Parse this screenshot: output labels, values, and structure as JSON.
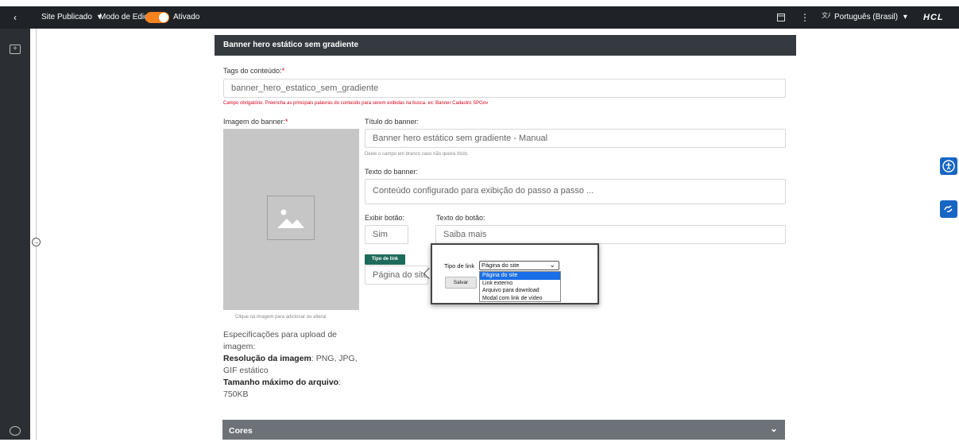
{
  "topbar": {
    "back_icon": "chevron-left-icon",
    "site_label": "Site Publicado",
    "site_caret": "▾",
    "edit_mode_label": "Modo de Edição:",
    "edit_mode_status": "Ativado",
    "language": "Português (Brasil)",
    "language_caret": "▾",
    "brand": "HCL",
    "accent_color": "#f5821f"
  },
  "panel": {
    "title": "Banner hero estático sem gradiente",
    "tags_label": "Tags do conteúdo:",
    "required_mark": "*",
    "tags_value": "banner_hero_estatico_sem_gradiente",
    "tags_error": "Campo obrigatório. Preencha as principais palavras do conteúdo para serem exibidas na busca. ex: Banner Cadastro SPGov",
    "image_label": "Imagem do banner:",
    "image_hint": "Clique na imagem para adicionar ou alterar",
    "spec_intro": "Especificações para upload de imagem:",
    "spec_res_label": "Resolução da imagem",
    "spec_res_value": ": PNG, JPG, GIF estático",
    "spec_size_label": "Tamanho máximo do arquivo",
    "spec_size_value": ":",
    "spec_size_amount": "750KB",
    "title_label": "Título do banner:",
    "title_value": "Banner hero estático sem gradiente - Manual",
    "title_hint": "Deixe o campo em branco caso não queira título.",
    "text_label": "Texto do banner:",
    "text_value": "Conteúdo configurado para exibição do passo a passo ...",
    "show_button_label": "Exibir botão:",
    "show_button_value": "Sim",
    "button_text_label": "Texto do botão:",
    "button_text_value": "Saiba mais",
    "link_type_badge": "Tipo de link",
    "link_type_value": "Página do site",
    "colors_section": "Cores",
    "colors_chevron": "⌄"
  },
  "popup": {
    "field_label": "Tipo de link",
    "selected": "Página do site",
    "save_label": "Salvar",
    "options": [
      "Página do site",
      "Link externo",
      "Arquivo para download",
      "Modal com link de vídeo"
    ],
    "highlight_color": "#1a6ee8"
  },
  "icons": {
    "image_placeholder": "image-icon",
    "accessibility": "accessibility-icon",
    "sign_language": "sign-language-icon"
  }
}
